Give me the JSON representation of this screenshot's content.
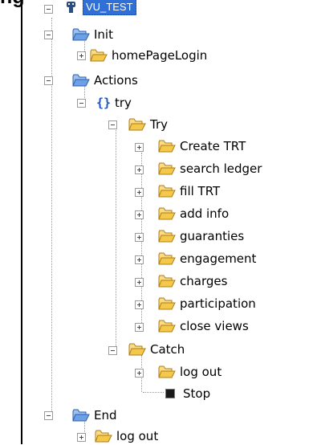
{
  "heading": "ng",
  "tree": {
    "root_label": "VU_TEST",
    "init": {
      "label": "Init",
      "home_page_login": "homePageLogin"
    },
    "actions": {
      "label": "Actions",
      "try_block": {
        "label": "try",
        "try": {
          "label": "Try",
          "items": [
            "Create TRT",
            "search ledger",
            "fill TRT",
            "add info",
            "guaranties",
            "engagement",
            "charges",
            "participation",
            "close views"
          ]
        },
        "catch": {
          "label": "Catch",
          "log_out": "log out",
          "stop": "Stop"
        }
      }
    },
    "end": {
      "label": "End",
      "log_out": "log out"
    }
  },
  "colors": {
    "selection": "#2f6fd6",
    "brace": "#1f55b8",
    "folder_blue": "#6ea0e8",
    "folder_yellow": "#f4c84a"
  },
  "icons": {
    "root": "script-vu-icon",
    "blue_folder": "open-folder-blue-icon",
    "yellow_folder": "folder-yellow-icon",
    "block": "curly-braces-icon",
    "stop": "stop-square-icon"
  }
}
